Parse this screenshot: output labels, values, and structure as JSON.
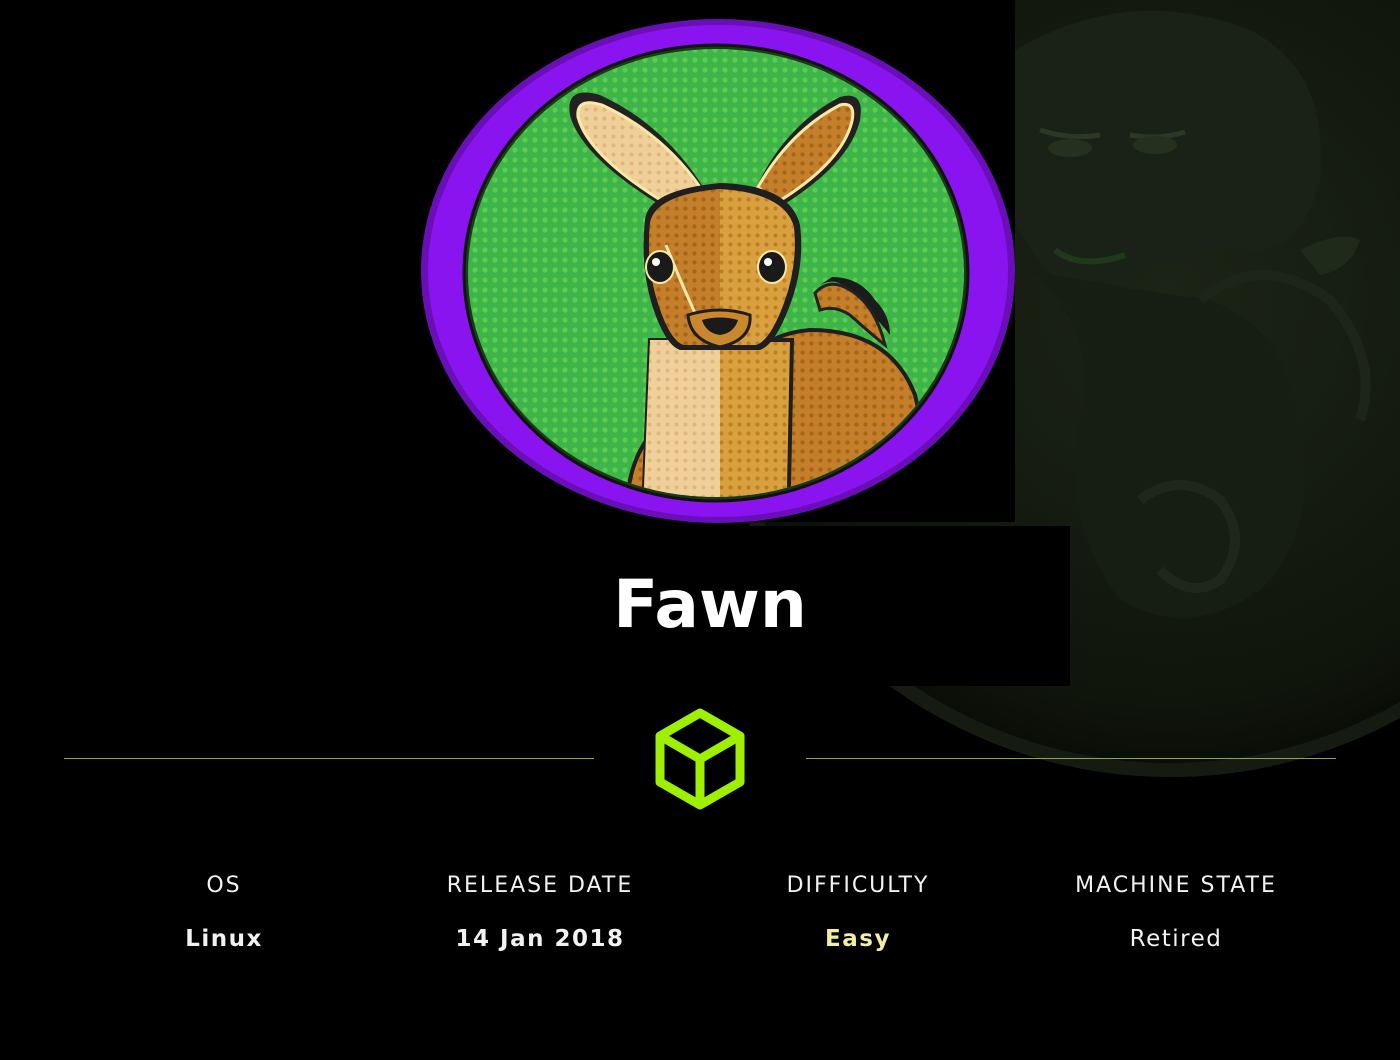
{
  "machine": {
    "name": "Fawn"
  },
  "colors": {
    "ring": "#8a14f0",
    "badge_bg": "#3db548",
    "accent_green": "#9fef00",
    "divider": "#8fa544",
    "difficulty_easy": "#f2f0a0"
  },
  "icons": {
    "avatar": "fawn-deer-avatar",
    "brand": "hackthebox-cube-icon"
  },
  "info": [
    {
      "label": "OS",
      "value": "Linux"
    },
    {
      "label": "RELEASE DATE",
      "value": "14 Jan 2018"
    },
    {
      "label": "DIFFICULTY",
      "value": "Easy"
    },
    {
      "label": "MACHINE STATE",
      "value": "Retired"
    }
  ]
}
